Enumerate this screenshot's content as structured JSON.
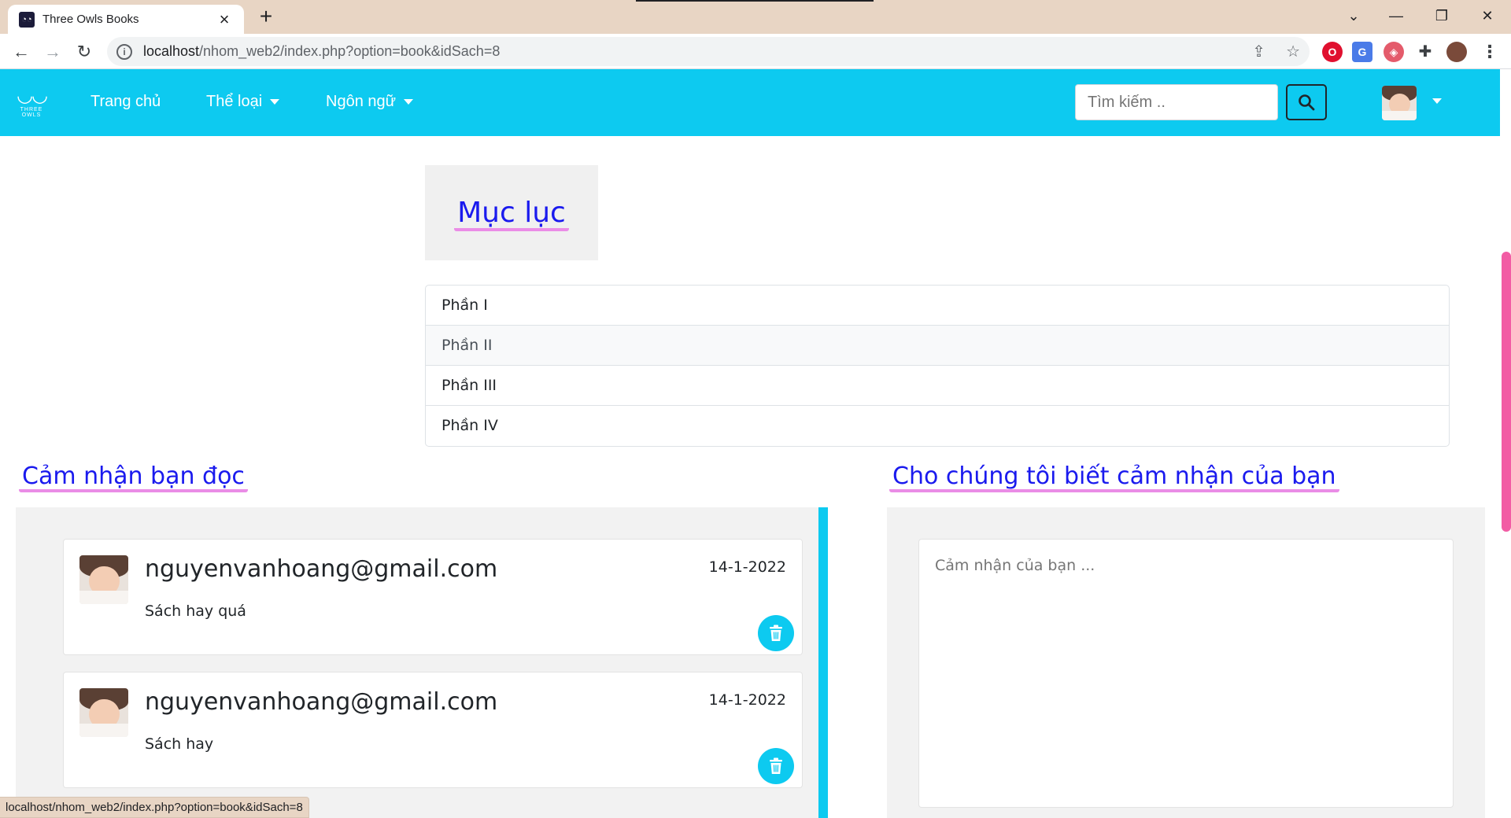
{
  "browser": {
    "tab_title": "Three Owls Books",
    "url_host": "localhost",
    "url_path": "/nhom_web2/index.php?option=book&idSach=8",
    "status_url": "localhost/nhom_web2/index.php?option=book&idSach=8"
  },
  "navbar": {
    "logo_text": "THREE OWLS",
    "home": "Trang chủ",
    "genre": "Thể loại",
    "language": "Ngôn ngữ",
    "search_placeholder": "Tìm kiếm .."
  },
  "toc": {
    "title": "Mục lục",
    "items": [
      "Phần I",
      "Phần II",
      "Phần III",
      "Phần IV"
    ],
    "active_index": 1
  },
  "reviews": {
    "title": "Cảm nhận bạn đọc",
    "items": [
      {
        "email": "nguyenvanhoang@gmail.com",
        "date": "14-1-2022",
        "text": "Sách hay quá"
      },
      {
        "email": "nguyenvanhoang@gmail.com",
        "date": "14-1-2022",
        "text": "Sách hay"
      }
    ]
  },
  "feedback": {
    "title": "Cho chúng tôi biết cảm nhận của bạn",
    "placeholder": "Cảm nhận của bạn ..."
  },
  "colors": {
    "brand": "#0dcaf0",
    "heading": "#1a1aee",
    "highlight": "#ea8ce6",
    "scrollbar": "#f25ca4"
  }
}
